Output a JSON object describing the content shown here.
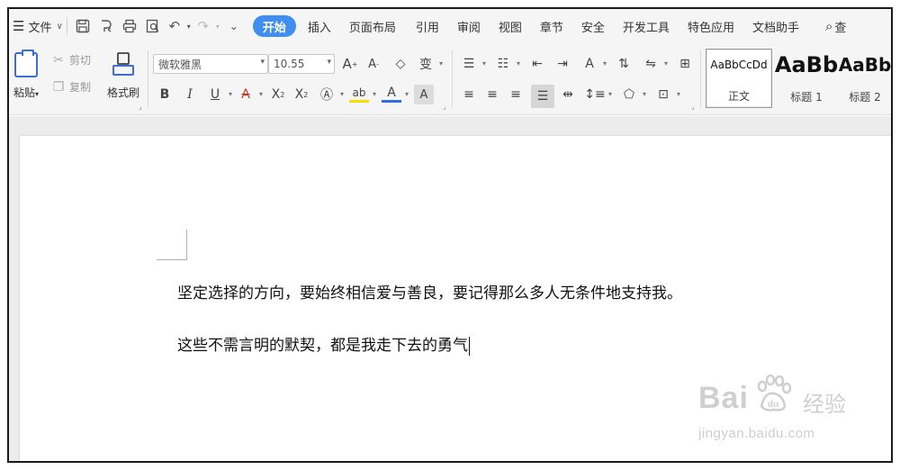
{
  "menubar": {
    "file_label": "文件",
    "tabs": [
      {
        "label": "开始",
        "active": true
      },
      {
        "label": "插入"
      },
      {
        "label": "页面布局"
      },
      {
        "label": "引用"
      },
      {
        "label": "审阅"
      },
      {
        "label": "视图"
      },
      {
        "label": "章节"
      },
      {
        "label": "安全"
      },
      {
        "label": "开发工具"
      },
      {
        "label": "特色应用"
      },
      {
        "label": "文档助手"
      }
    ],
    "search_label": "查"
  },
  "ribbon": {
    "paste_label": "粘贴",
    "cut_label": "剪切",
    "copy_label": "复制",
    "format_painter_label": "格式刷",
    "font_name": "微软雅黑",
    "font_size": "10.55",
    "styles": [
      {
        "sample": "AaBbCcDd",
        "name": "正文",
        "selected": true
      },
      {
        "sample": "AaBb",
        "name": "标题 1"
      },
      {
        "sample": "AaBb",
        "name": "标题 2"
      }
    ],
    "accent_color": "#3f8ef0"
  },
  "document": {
    "paragraph_1": "坚定选择的方向，要始终相信爱与善良，要记得那么多人无条件地支持我。",
    "paragraph_2": "这些不需言明的默契，都是我走下去的勇气"
  },
  "watermark": {
    "brand": "Bai",
    "brand_cn": "经验",
    "url": "jingyan.baidu.com"
  }
}
